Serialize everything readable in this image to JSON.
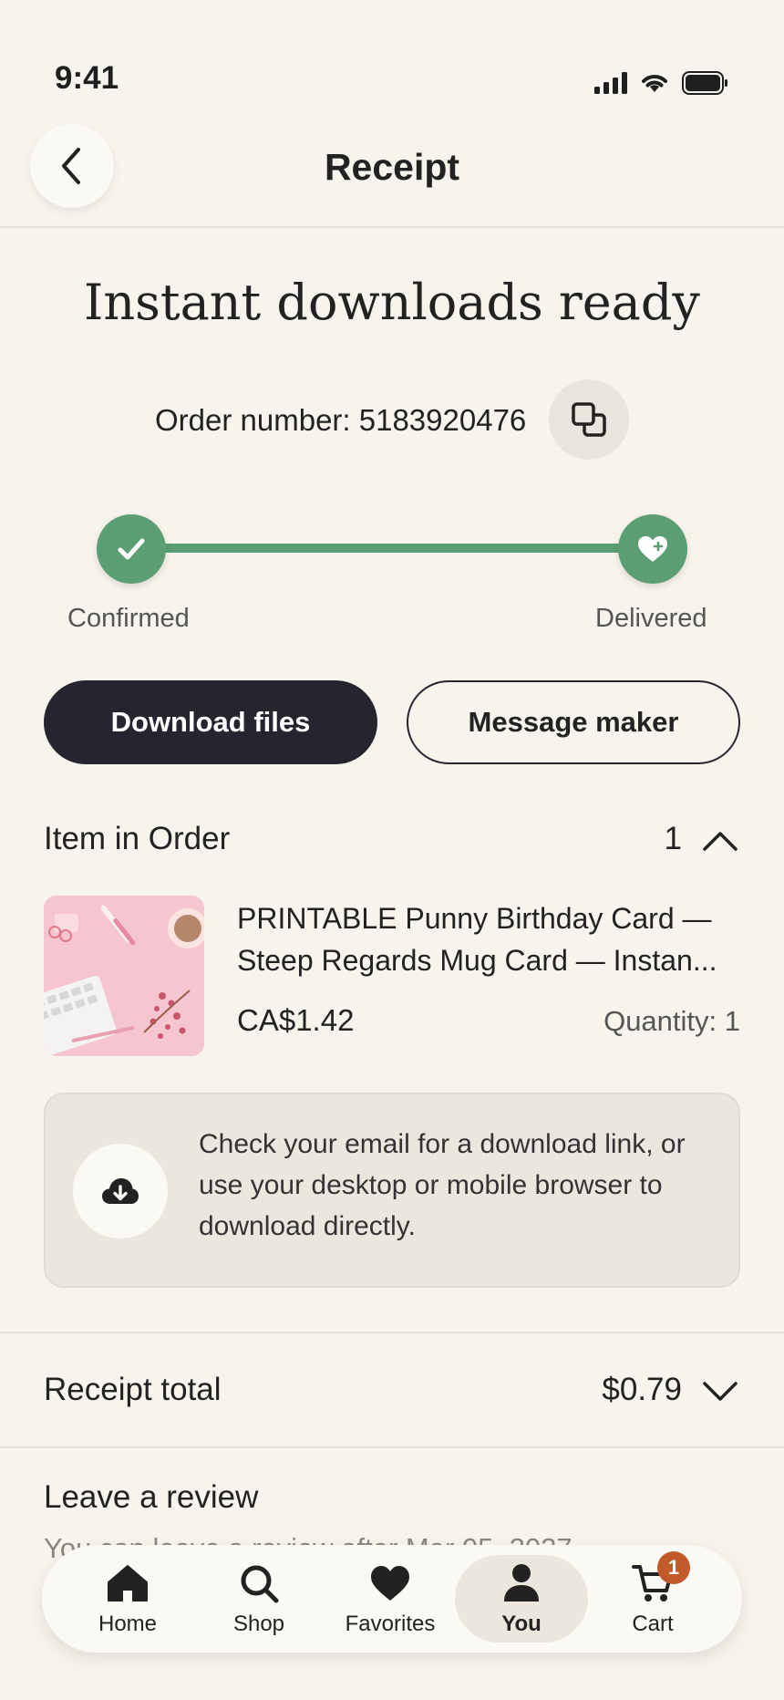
{
  "status_bar": {
    "time": "9:41",
    "icons": [
      "signal-icon",
      "wifi-icon",
      "battery-icon"
    ]
  },
  "header": {
    "title": "Receipt",
    "back_icon": "chevron-left-icon"
  },
  "hero": {
    "title": "Instant downloads ready"
  },
  "order": {
    "number_text": "Order number: 5183920476",
    "copy_icon": "copy-icon"
  },
  "progress": {
    "steps": [
      {
        "label": "Confirmed",
        "icon": "check-icon",
        "done": true
      },
      {
        "label": "Delivered",
        "icon": "heart-plus-icon",
        "done": true
      }
    ],
    "color": "#5c9e73",
    "fraction_complete": 1.0
  },
  "actions": {
    "primary_label": "Download files",
    "secondary_label": "Message maker"
  },
  "items_section": {
    "label": "Item in Order",
    "count": "1",
    "expanded": true,
    "items": [
      {
        "title": "PRINTABLE Punny Birthday Card — Steep Regards Mug Card — Instan...",
        "price": "CA$1.42",
        "quantity": "Quantity: 1"
      }
    ]
  },
  "info": {
    "icon": "cloud-download-icon",
    "text": "Check your email for a download link, or use your desktop or mobile browser to download directly."
  },
  "receipt": {
    "label": "Receipt total",
    "value": "$0.79"
  },
  "review": {
    "title": "Leave a review",
    "subtitle": "You can leave a review after Mar 05, 2027"
  },
  "tabbar": {
    "tabs": [
      {
        "label": "Home",
        "icon": "home-icon"
      },
      {
        "label": "Shop",
        "icon": "search-icon"
      },
      {
        "label": "Favorites",
        "icon": "heart-icon"
      },
      {
        "label": "You",
        "icon": "person-icon",
        "active": true
      },
      {
        "label": "Cart",
        "icon": "cart-icon",
        "badge": "1"
      }
    ]
  },
  "colors": {
    "background": "#f7f4ed",
    "primary": "#26252f",
    "success": "#5c9e73",
    "badge": "#c25a2a"
  }
}
